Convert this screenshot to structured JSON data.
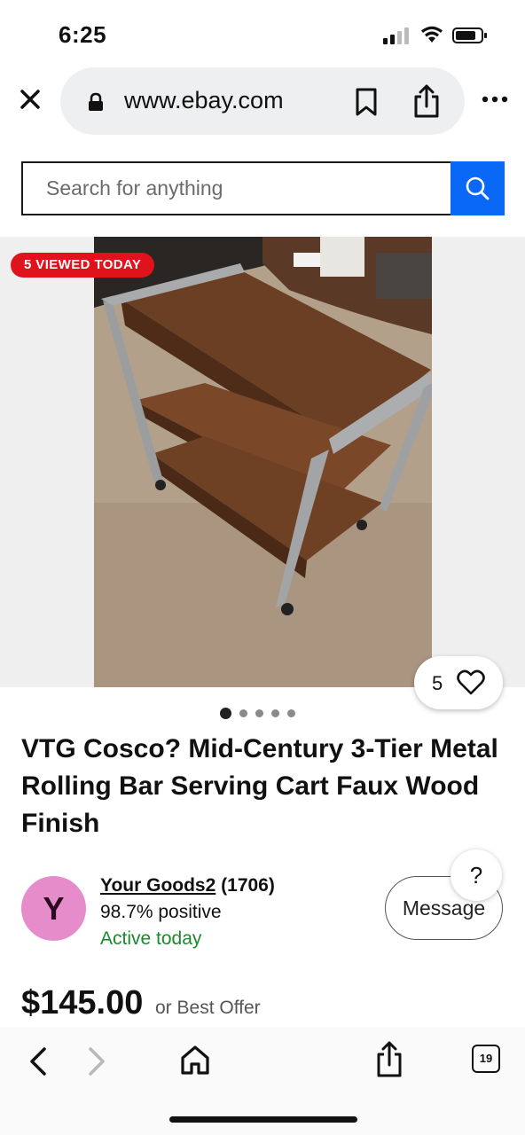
{
  "status_bar": {
    "time": "6:25"
  },
  "browser": {
    "url": "www.ebay.com"
  },
  "search": {
    "placeholder": "Search for anything"
  },
  "listing": {
    "viewed_badge": "5 VIEWED TODAY",
    "watch_count": "5",
    "image_count": 5,
    "active_image_index": 1,
    "title": "VTG Cosco? Mid-Century 3-Tier Metal Rolling Bar Serving Cart Faux Wood Finish",
    "price": "$145.00",
    "best_offer": "or Best Offer"
  },
  "seller": {
    "initial": "Y",
    "name": "Your Goods2",
    "feedback_count": "(1706)",
    "positive": "98.7% positive",
    "activity": "Active today"
  },
  "actions": {
    "message": "Message",
    "help": "?"
  },
  "toolbar": {
    "tab_count": "19"
  },
  "colors": {
    "ebay_blue": "#0968f6",
    "badge_red": "#e0121b",
    "avatar_pink": "#e68ccb",
    "active_green": "#1a8a2a"
  },
  "icons": [
    "close-icon",
    "lock-icon",
    "bookmark-icon",
    "share-icon",
    "more-icon",
    "search-icon",
    "heart-icon",
    "back-icon",
    "forward-icon",
    "home-icon",
    "tabs-icon"
  ]
}
